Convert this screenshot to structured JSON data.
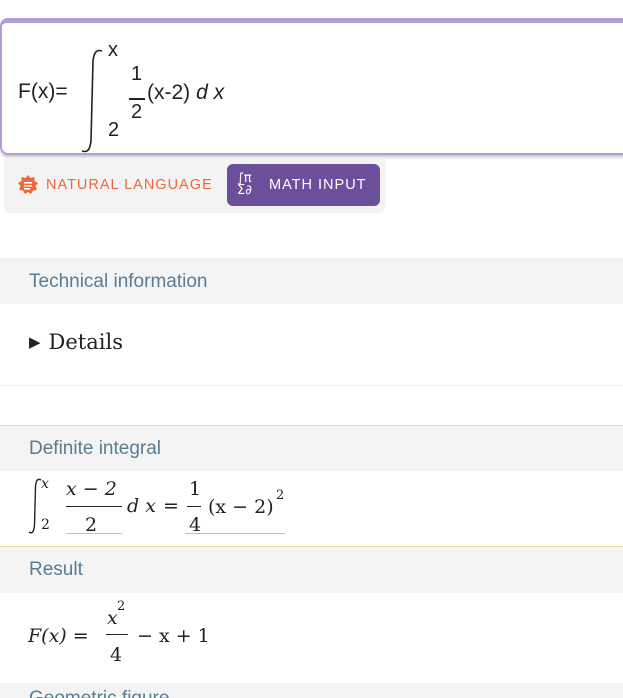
{
  "input": {
    "function_label": "F(x)=",
    "upper_limit": "x",
    "lower_limit": "2",
    "fraction_numerator": "1",
    "fraction_denominator": "2",
    "integrand": "(x-2)",
    "differential": "d x"
  },
  "mode": {
    "natural_language_label": "NATURAL LANGUAGE",
    "math_input_label": "MATH INPUT",
    "math_input_icon_text": "∫π Σ∂",
    "active": "MATH INPUT",
    "colors": {
      "natural_language": "#f0673a",
      "math_input_bg": "#6b4f9a"
    }
  },
  "technical_info": {
    "title": "Technical information",
    "details_label": "Details"
  },
  "definite_integral": {
    "title": "Definite integral",
    "upper": "x",
    "lower": "2",
    "numerator": "x − 2",
    "denominator": "2",
    "differential": "d x",
    "equals": "=",
    "rhs_numerator": "1",
    "rhs_denominator": "4",
    "rhs_body": "(x − 2)",
    "rhs_exponent": "2"
  },
  "result": {
    "title": "Result",
    "lhs": "F(x) =",
    "numerator_base": "x",
    "numerator_exponent": "2",
    "denominator": "4",
    "tail": "− x + 1"
  },
  "geometric_figure": {
    "title": "Geometric figure"
  }
}
